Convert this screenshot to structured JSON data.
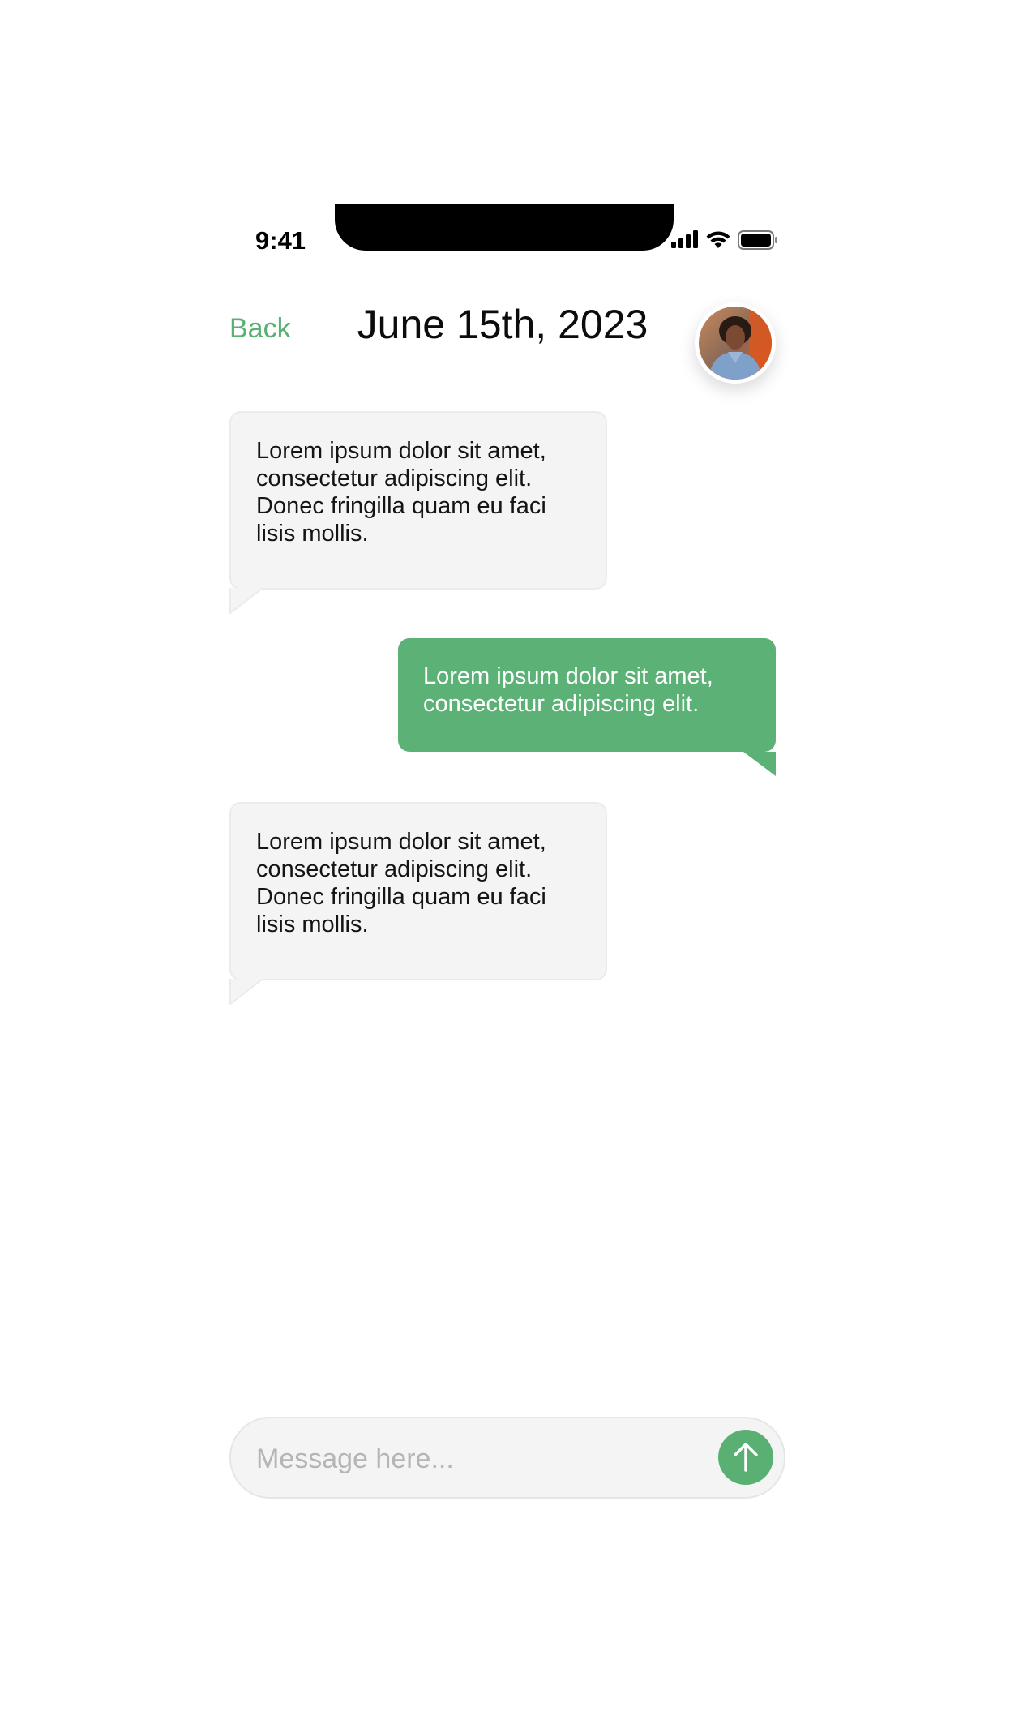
{
  "status_bar": {
    "time": "9:41",
    "icons": [
      "signal-icon",
      "wifi-icon",
      "battery-icon"
    ]
  },
  "header": {
    "back_label": "Back",
    "title": "June 15th, 2023",
    "avatar_icon": "avatar"
  },
  "messages": [
    {
      "direction": "incoming",
      "text": "Lorem ipsum dolor sit amet,\nconsectetur adipiscing elit.\nDonec fringilla quam eu faci\nlisis mollis."
    },
    {
      "direction": "outgoing",
      "text": "Lorem ipsum dolor sit amet,\nconsectetur adipiscing elit."
    },
    {
      "direction": "incoming",
      "text": "Lorem ipsum dolor sit amet,\nconsectetur adipiscing elit.\nDonec fringilla quam eu faci\nlisis mollis."
    }
  ],
  "composer": {
    "placeholder": "Message here...",
    "value": "",
    "send_icon": "arrow-up-icon"
  },
  "colors": {
    "accent": "#5aaf73",
    "incoming_bubble": "#f4f4f4",
    "outgoing_bubble": "#5cb176",
    "composer_background": "#f4f4f4"
  }
}
